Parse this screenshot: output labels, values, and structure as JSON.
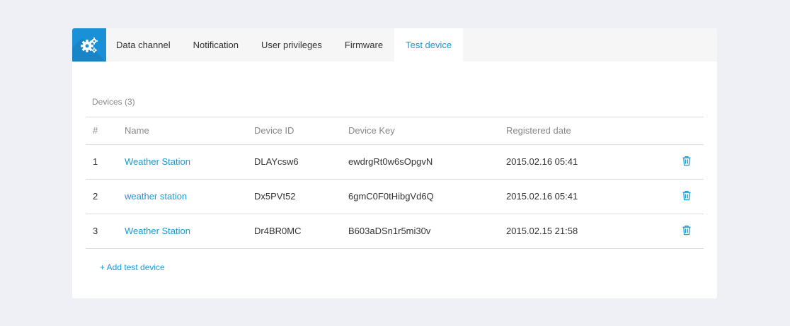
{
  "tabs": [
    {
      "label": "Data channel"
    },
    {
      "label": "Notification"
    },
    {
      "label": "User privileges"
    },
    {
      "label": "Firmware"
    },
    {
      "label": "Test device"
    }
  ],
  "active_tab": "Test device",
  "devices": {
    "title": "Devices (3)",
    "columns": {
      "num": "#",
      "name": "Name",
      "device_id": "Device ID",
      "device_key": "Device Key",
      "registered": "Registered date"
    },
    "rows": [
      {
        "num": "1",
        "name": "Weather Station",
        "device_id": "DLAYcsw6",
        "device_key": "ewdrgRt0w6sOpgvN",
        "registered": "2015.02.16 05:41"
      },
      {
        "num": "2",
        "name": "weather station",
        "device_id": "Dx5PVt52",
        "device_key": "6gmC0F0tHibgVd6Q",
        "registered": "2015.02.16 05:41"
      },
      {
        "num": "3",
        "name": "Weather Station",
        "device_id": "Dr4BR0MC",
        "device_key": "B603aDSn1r5mi30v",
        "registered": "2015.02.15 21:58"
      }
    ],
    "add_label": "+ Add test device"
  },
  "icons": {
    "settings": "gears-icon",
    "delete": "trash-icon"
  },
  "colors": {
    "accent": "#1a9ad6",
    "settings_bg": "#1a91d6",
    "page_bg": "#eff0f5"
  }
}
